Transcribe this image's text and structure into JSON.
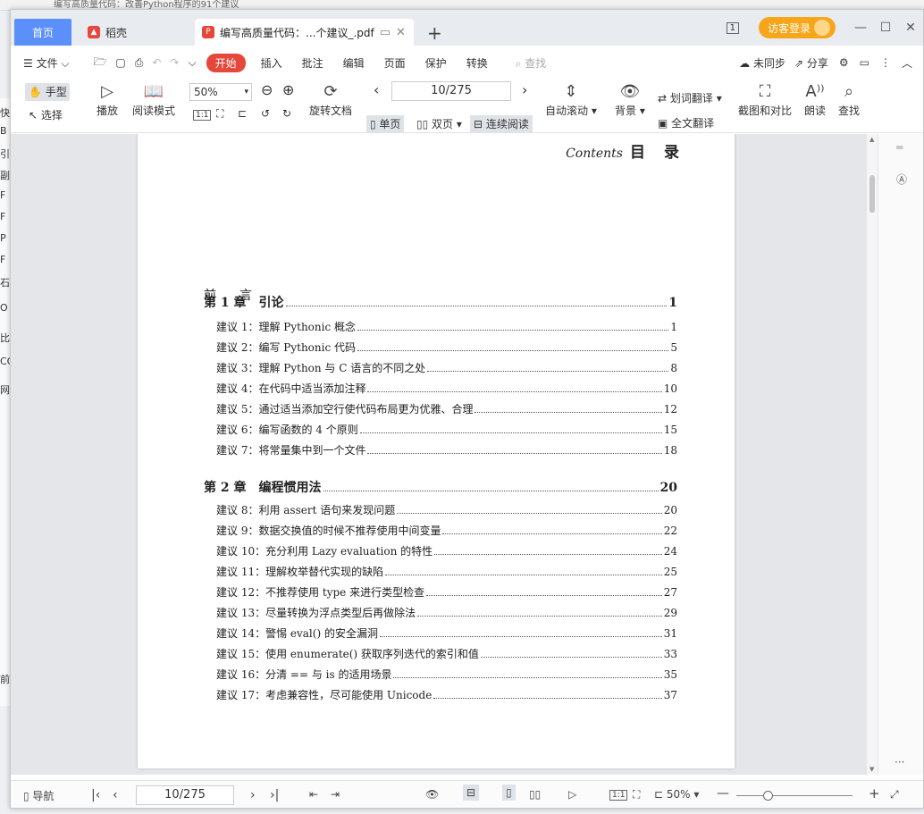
{
  "background": {
    "title_strip": "编写高质量代码：改善Python程序的91个建议",
    "left_chars": [
      "快",
      "B",
      "引",
      "副",
      "F",
      "F",
      "P",
      "F",
      "石",
      "O",
      "比",
      "CC",
      "网",
      "前"
    ]
  },
  "tabs": {
    "home": "首页",
    "daoke": "稻壳",
    "doc": "编写高质量代码：...个建议_.pdf",
    "add": "+"
  },
  "window": {
    "login": "访客登录",
    "layout_icon": "1",
    "minimize": "—",
    "maximize": "☐",
    "close": "✕"
  },
  "menu": {
    "file": "文件",
    "start": "开始",
    "items": [
      "插入",
      "批注",
      "编辑",
      "页面",
      "保护",
      "转换"
    ],
    "search": "查找",
    "sync": "未同步",
    "share": "分享"
  },
  "ribbon": {
    "hand": "手型",
    "select": "选择",
    "play": "播放",
    "read_mode": "阅读模式",
    "zoom": "50%",
    "actual_size": "1:1",
    "rotate": "旋转文档",
    "page": "10/275",
    "single": "单页",
    "double": "双页",
    "continuous": "连续阅读",
    "auto_scroll": "自动滚动",
    "background": "背景",
    "word_translate": "划词翻译",
    "full_translate": "全文翻译",
    "screenshot": "截图和对比",
    "read_aloud": "朗读",
    "find": "查找"
  },
  "document": {
    "contents_en": "Contents",
    "contents_cn": "目　录",
    "preface": "前　言",
    "toc": [
      {
        "type": "chapter",
        "text": "第 1 章　引论",
        "page": "1"
      },
      {
        "type": "item",
        "text": "建议 1：理解 Pythonic 概念",
        "page": "1"
      },
      {
        "type": "item",
        "text": "建议 2：编写 Pythonic 代码",
        "page": "5"
      },
      {
        "type": "item",
        "text": "建议 3：理解 Python 与 C 语言的不同之处",
        "page": "8"
      },
      {
        "type": "item",
        "text": "建议 4：在代码中适当添加注释",
        "page": "10"
      },
      {
        "type": "item",
        "text": "建议 5：通过适当添加空行使代码布局更为优雅、合理",
        "page": "12"
      },
      {
        "type": "item",
        "text": "建议 6：编写函数的 4 个原则",
        "page": "15"
      },
      {
        "type": "item",
        "text": "建议 7：将常量集中到一个文件",
        "page": "18"
      },
      {
        "type": "chapter",
        "text": "第 2 章　编程惯用法",
        "page": "20"
      },
      {
        "type": "item",
        "text": "建议 8：利用 assert 语句来发现问题",
        "page": "20"
      },
      {
        "type": "item",
        "text": "建议 9：数据交换值的时候不推荐使用中间变量",
        "page": "22"
      },
      {
        "type": "item",
        "text": "建议 10：充分利用 Lazy evaluation 的特性",
        "page": "24"
      },
      {
        "type": "item",
        "text": "建议 11：理解枚举替代实现的缺陷",
        "page": "25"
      },
      {
        "type": "item",
        "text": "建议 12：不推荐使用 type 来进行类型检查",
        "page": "27"
      },
      {
        "type": "item",
        "text": "建议 13：尽量转换为浮点类型后再做除法",
        "page": "29"
      },
      {
        "type": "item",
        "text": "建议 14：警惕 eval() 的安全漏洞",
        "page": "31"
      },
      {
        "type": "item",
        "text": "建议 15：使用 enumerate() 获取序列迭代的索引和值",
        "page": "33"
      },
      {
        "type": "item",
        "text": "建议 16：分清 == 与 is 的适用场景",
        "page": "35"
      },
      {
        "type": "item",
        "text": "建议 17：考虑兼容性，尽可能使用 Unicode",
        "page": "37"
      }
    ]
  },
  "statusbar": {
    "nav": "导航",
    "page": "10/275",
    "zoom": "50%",
    "more": "···"
  },
  "colors": {
    "accent_blue": "#5b8ff9",
    "start_red": "#e5473a",
    "login_orange": "#f7a619"
  }
}
